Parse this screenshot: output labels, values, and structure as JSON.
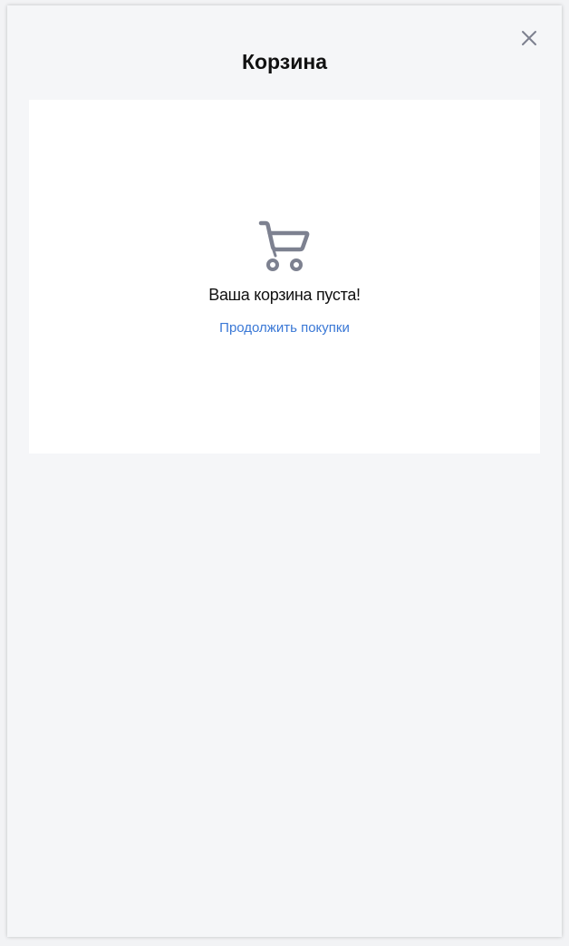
{
  "modal": {
    "title": "Корзина",
    "close_icon": "close-icon"
  },
  "cart": {
    "icon": "shopping-cart-icon",
    "empty_message": "Ваша корзина пуста!",
    "continue_link": "Продолжить покупки"
  },
  "colors": {
    "background": "#f5f6f8",
    "card": "#ffffff",
    "icon": "#7d8190",
    "link": "#3a78d6",
    "text": "#111111"
  }
}
